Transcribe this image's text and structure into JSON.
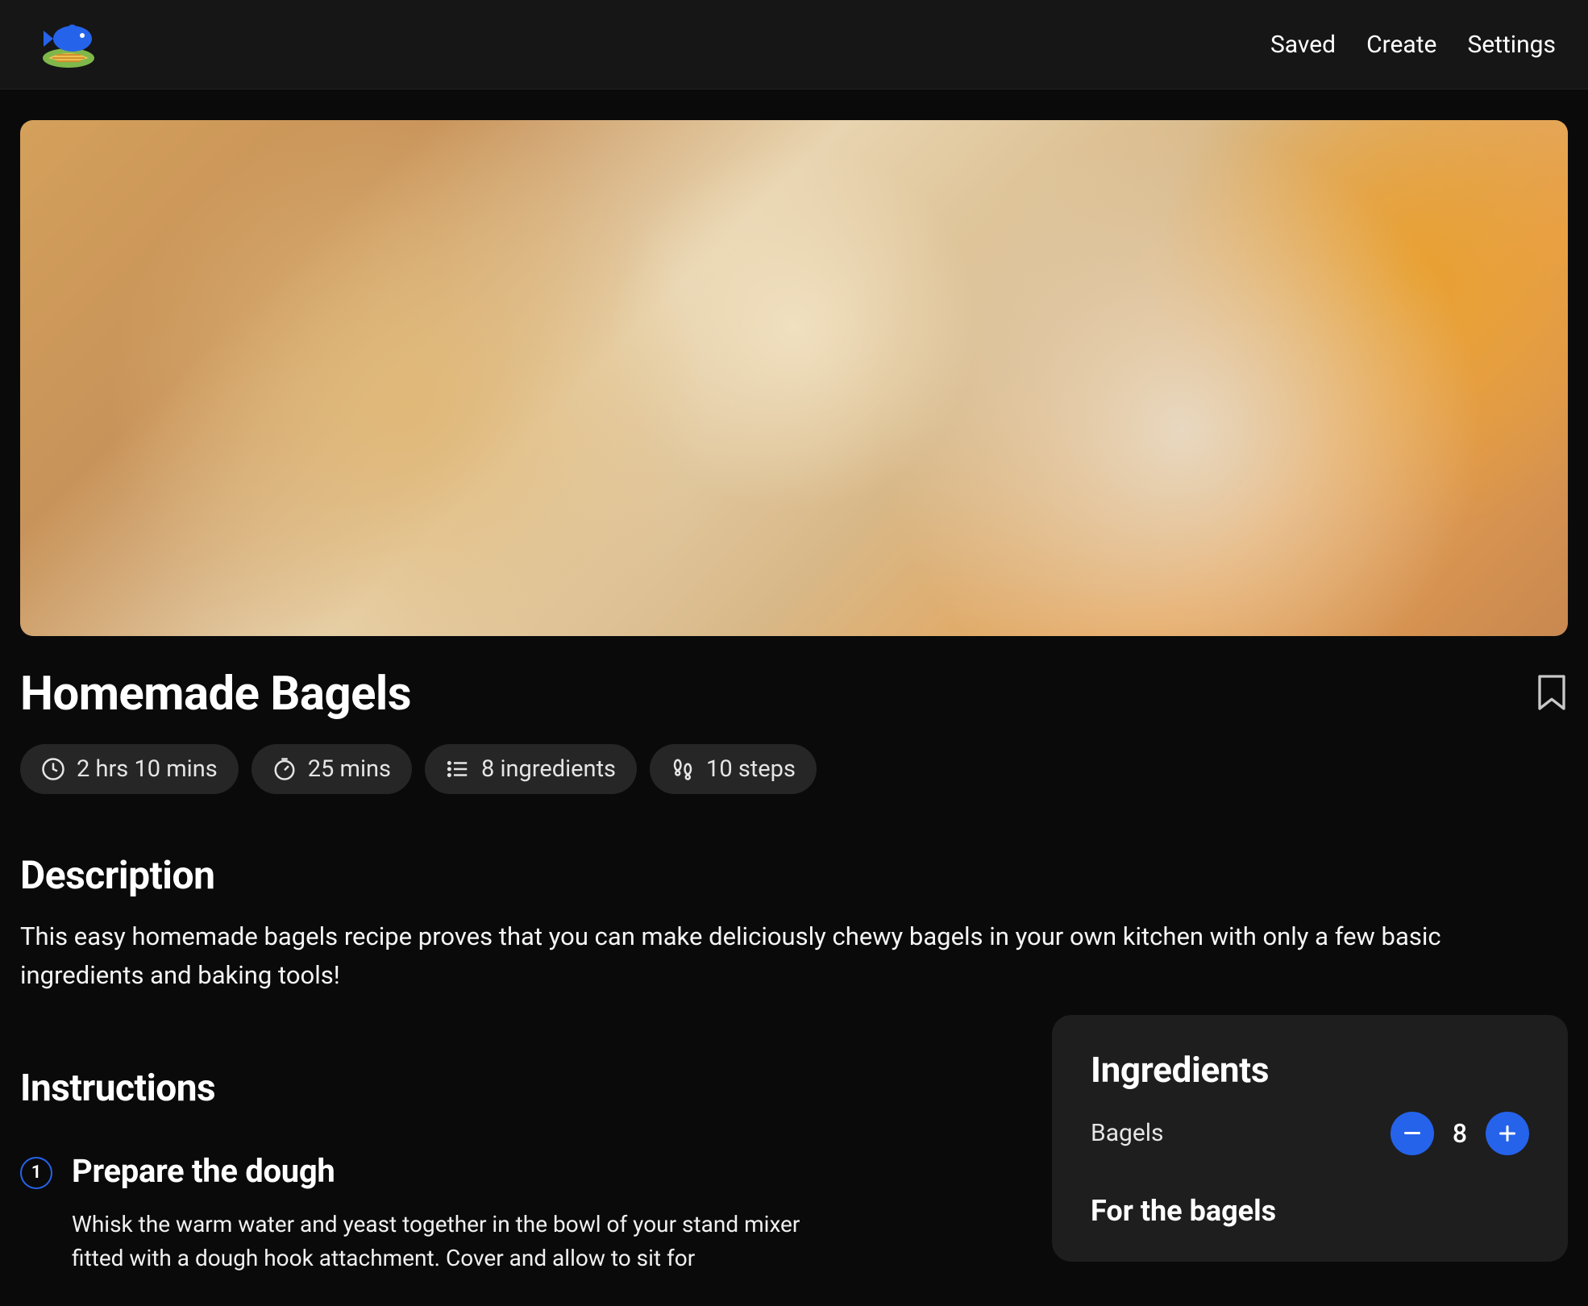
{
  "nav": {
    "saved": "Saved",
    "create": "Create",
    "settings": "Settings"
  },
  "recipe": {
    "title": "Homemade Bagels",
    "badges": {
      "total_time": "2 hrs 10 mins",
      "active_time": "25 mins",
      "ingredients": "8 ingredients",
      "steps": "10 steps"
    },
    "description_heading": "Description",
    "description": "This easy homemade bagels recipe proves that you can make deliciously chewy bagels in your own kitchen with only a few basic ingredients and baking tools!",
    "instructions_heading": "Instructions",
    "steps": [
      {
        "number": "1",
        "title": "Prepare the dough",
        "body": "Whisk the warm water and yeast together in the bowl of your stand mixer fitted with a dough hook attachment. Cover and allow to sit for"
      }
    ]
  },
  "ingredients": {
    "heading": "Ingredients",
    "unit_label": "Bagels",
    "quantity": "8",
    "group_heading": "For the bagels"
  }
}
